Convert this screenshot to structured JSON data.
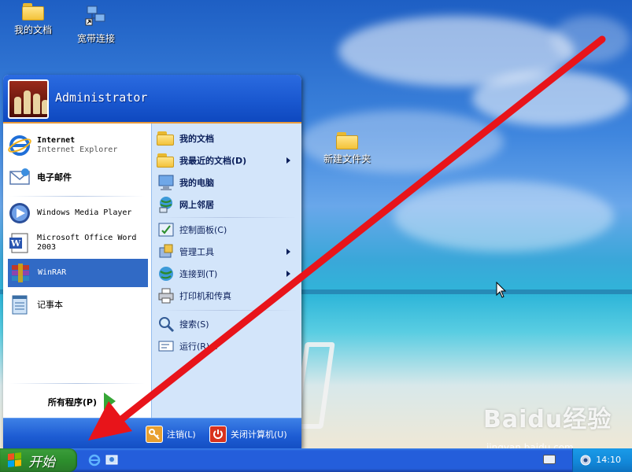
{
  "desktop": {
    "icons": [
      {
        "label": "我的文档",
        "icon": "my-documents-icon"
      },
      {
        "label": "宽带连接",
        "icon": "broadband-connection-icon"
      },
      {
        "label": "新建文件夹",
        "icon": "folder-icon"
      }
    ],
    "watermark": "Baidu经验",
    "watermark_sub": "jingyan.baidu.com"
  },
  "start_menu": {
    "user": "Administrator",
    "pinned": [
      {
        "title": "Internet",
        "subtitle": "Internet Explorer",
        "icon": "internet-explorer-icon"
      },
      {
        "title": "电子邮件",
        "icon": "email-icon"
      }
    ],
    "recent": [
      {
        "label": "Windows Media Player",
        "icon": "windows-media-player-icon"
      },
      {
        "label": "Microsoft Office Word 2003",
        "icon": "word-icon"
      },
      {
        "label": "WinRAR",
        "icon": "winrar-icon",
        "selected": true
      },
      {
        "label": "记事本",
        "icon": "notepad-icon"
      }
    ],
    "all_programs": "所有程序(P)",
    "right": [
      {
        "label": "我的文档",
        "icon": "my-documents-icon"
      },
      {
        "label": "我最近的文档(D)",
        "icon": "recent-documents-icon",
        "submenu": true
      },
      {
        "label": "我的电脑",
        "icon": "my-computer-icon"
      },
      {
        "label": "网上邻居",
        "icon": "network-places-icon"
      },
      {
        "label": "控制面板(C)",
        "icon": "control-panel-icon"
      },
      {
        "label": "管理工具",
        "icon": "admin-tools-icon",
        "submenu": true
      },
      {
        "label": "连接到(T)",
        "icon": "connect-to-icon",
        "submenu": true
      },
      {
        "label": "打印机和传真",
        "icon": "printer-icon"
      },
      {
        "label": "搜索(S)",
        "icon": "search-icon"
      },
      {
        "label": "运行(R)...",
        "icon": "run-icon"
      }
    ],
    "logoff": "注销(L)",
    "shutdown": "关闭计算机(U)"
  },
  "taskbar": {
    "start_label": "开始",
    "clock": "14:10"
  },
  "colors": {
    "start_green": "#2d8f2d",
    "menu_blue": "#1a58d0",
    "selection": "#316ac5",
    "arrow_red": "#e8141a"
  }
}
